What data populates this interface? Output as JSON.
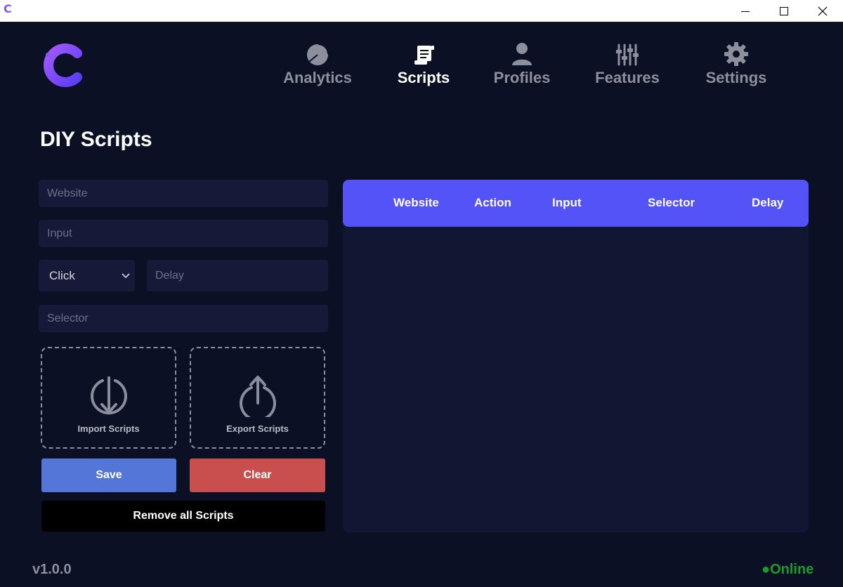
{
  "window": {
    "app_icon_glyph": "C",
    "controls": [
      "minimize-icon",
      "maximize-icon",
      "close-icon"
    ]
  },
  "colors": {
    "background": "#0b1024",
    "accent": "#5453f7",
    "save": "#5576d9",
    "clear": "#c94f4f",
    "online": "#1e9a2a",
    "logo": "#7b5cff"
  },
  "nav": {
    "items": [
      {
        "label": "Analytics",
        "icon": "pie-chart-icon",
        "active": false
      },
      {
        "label": "Scripts",
        "icon": "scroll-icon",
        "active": true
      },
      {
        "label": "Profiles",
        "icon": "user-icon",
        "active": false
      },
      {
        "label": "Features",
        "icon": "sliders-icon",
        "active": false
      },
      {
        "label": "Settings",
        "icon": "gear-icon",
        "active": false
      }
    ]
  },
  "page": {
    "title": "DIY Scripts"
  },
  "form": {
    "website_placeholder": "Website",
    "input_placeholder": "Input",
    "action_selected": "Click",
    "delay_placeholder": "Delay",
    "selector_placeholder": "Selector",
    "import_label": "Import Scripts",
    "export_label": "Export Scripts",
    "save_label": "Save",
    "clear_label": "Clear",
    "remove_all_label": "Remove all Scripts"
  },
  "table": {
    "columns": [
      "Website",
      "Action",
      "Input",
      "Selector",
      "Delay"
    ],
    "rows": []
  },
  "footer": {
    "version": "v1.0.0",
    "status": "●Online"
  }
}
